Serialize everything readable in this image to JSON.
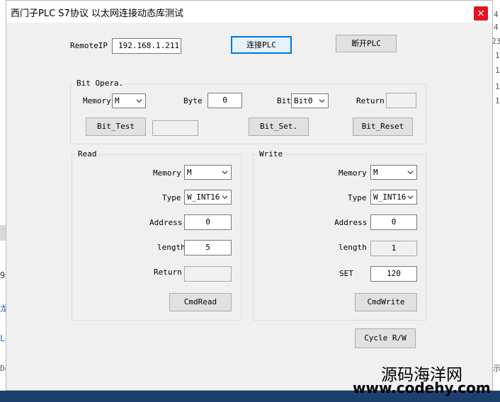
{
  "window": {
    "title": "西门子PLC  S7协议 以太网连接动态库测试",
    "close_glyph": "×"
  },
  "connection": {
    "remote_ip_label": "RemoteIP",
    "remote_ip_value": "192.168.1.211",
    "connect_button": "连接PLC",
    "disconnect_button": "断开PLC"
  },
  "bit_opera": {
    "caption": "Bit Opera.",
    "memory_label": "Memory",
    "memory_value": "M",
    "byte_label": "Byte",
    "byte_value": "0",
    "bit_label": "Bit",
    "bit_value": "Bit0",
    "return_label": "Return",
    "return_value": "",
    "test_button": "Bit_Test",
    "test_result": "",
    "set_button": "Bit_Set.",
    "reset_button": "Bit_Reset"
  },
  "read": {
    "caption": "Read",
    "memory_label": "Memory",
    "memory_value": "M",
    "type_label": "Type",
    "type_value": "W_INT16",
    "address_label": "Address",
    "address_value": "0",
    "length_label": "length",
    "length_value": "5",
    "return_label": "Return",
    "return_value": "",
    "button": "CmdRead"
  },
  "write": {
    "caption": "Write",
    "memory_label": "Memory",
    "memory_value": "M",
    "type_label": "Type",
    "type_value": "W_INT16",
    "address_label": "Address",
    "address_value": "0",
    "length_label": "length",
    "length_value": "1",
    "set_label": "SET",
    "set_value": "120",
    "button": "CmdWrite"
  },
  "cycle_button": "Cycle R/W",
  "background_fragments": {
    "right": [
      "4",
      "4",
      "23",
      "1",
      "1",
      "1",
      "1"
    ],
    "left": [
      "9",
      "龙",
      "L(",
      "De"
    ],
    "right_bottom": "示"
  },
  "watermark": {
    "name": "源码海洋网",
    "url": "www.codehy.com"
  },
  "colors": {
    "accent": "#0078d7",
    "close": "#e81123",
    "window_bg": "#f0f0f0"
  }
}
